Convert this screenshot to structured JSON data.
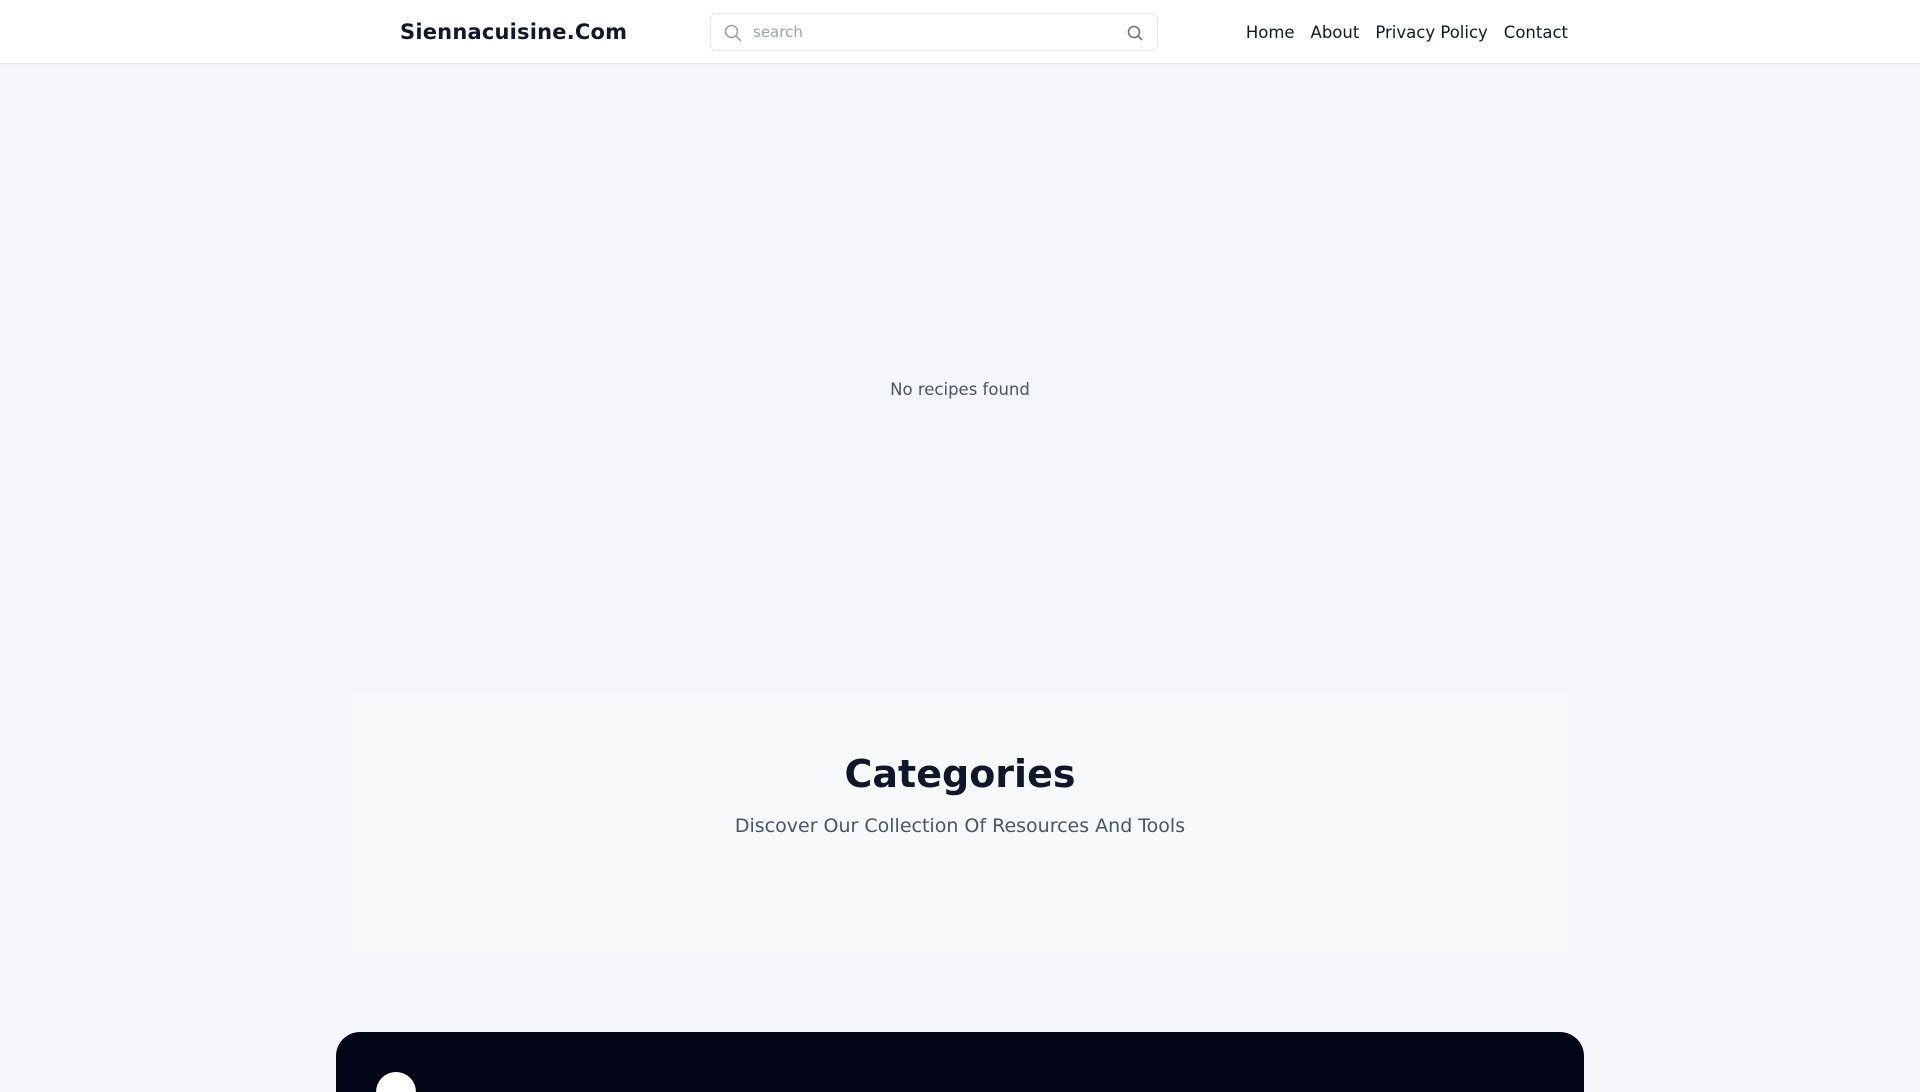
{
  "header": {
    "brand": "Siennacuisine.Com",
    "search": {
      "placeholder": "search",
      "value": "",
      "leading_icon": "search-icon",
      "submit_icon": "search-icon"
    },
    "nav": [
      {
        "label": "Home"
      },
      {
        "label": "About"
      },
      {
        "label": "Privacy Policy"
      },
      {
        "label": "Contact"
      }
    ]
  },
  "main": {
    "empty_message": "No recipes found"
  },
  "categories": {
    "title": "Categories",
    "subtitle": "Discover Our Collection Of Resources And Tools"
  },
  "footer": {
    "logo_icon": "logo-circle"
  },
  "colors": {
    "background": "#f4f6f9",
    "header_bg": "#ffffff",
    "text_primary": "#111827",
    "text_muted": "#4b5563",
    "footer_bg": "#020617"
  }
}
